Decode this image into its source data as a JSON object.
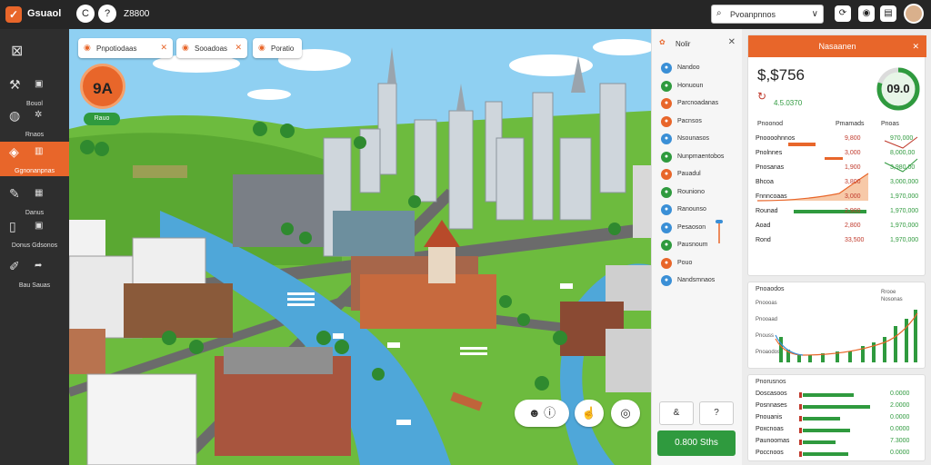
{
  "topbar": {
    "app_name": "Gsuaol",
    "code_text": "Z8800",
    "search_text": "Pvoanpnnos",
    "btn1_glyph": "C",
    "btn2_glyph": "?",
    "icons": [
      "back-icon",
      "help-icon",
      "search-icon",
      "refresh-icon",
      "camera-icon",
      "document-icon",
      "avatar"
    ]
  },
  "sidebar": {
    "items": [
      {
        "label": "Bouol",
        "icon": "wrench-icon"
      },
      {
        "label": "Rnaos",
        "icon": "globe-icon"
      },
      {
        "label": "Ggnonanpnas",
        "icon": "palette-icon"
      },
      {
        "label": "Danus",
        "icon": "tools-icon"
      },
      {
        "label": "Donus Gdsonos",
        "icon": "phone-icon"
      },
      {
        "label": "Bau Sauas",
        "icon": "edit-icon"
      }
    ]
  },
  "map": {
    "chips": [
      {
        "label": "Pnpotiodaas"
      },
      {
        "label": "Sooadoas"
      },
      {
        "label": "Poratio"
      }
    ],
    "score": "9A",
    "score_sub": "Rauo",
    "controls": [
      "person-icon",
      "info-icon",
      "pointer-icon",
      "chat-icon"
    ]
  },
  "midpanel": {
    "title": "Nolir",
    "rows": [
      {
        "label": "Nandoo",
        "color": "#3a8fd6"
      },
      {
        "label": "Honuoun",
        "color": "#2f9a3e"
      },
      {
        "label": "Parcnoadanas",
        "color": "#e8662a"
      },
      {
        "label": "Pacnsos",
        "color": "#e8662a"
      },
      {
        "label": "Nsounasos",
        "color": "#3a8fd6"
      },
      {
        "label": "Nunpmaentobos",
        "color": "#2f9a3e"
      },
      {
        "label": "Pauadul",
        "color": "#e8662a"
      },
      {
        "label": "Rouniono",
        "color": "#2f9a3e"
      },
      {
        "label": "Ranounso",
        "color": "#3a8fd6"
      },
      {
        "label": "Pesaoson",
        "color": "#3a8fd6"
      },
      {
        "label": "Pausnoum",
        "color": "#2f9a3e"
      },
      {
        "label": "Pouo",
        "color": "#e8662a"
      },
      {
        "label": "Nandsmnaos",
        "color": "#3a8fd6"
      }
    ],
    "btn_left": "&",
    "btn_right": "?",
    "cta": "0.800 Sths"
  },
  "rightpanel": {
    "title": "Nasaanen",
    "big_value": "$,$756",
    "ring_value": "09.0",
    "ring_fraction": 0.8,
    "delta": "4.5.0370",
    "headers": [
      "Pnoonod",
      "Pmamads",
      "Pnoas"
    ],
    "rows": [
      {
        "name": "Pnoooohnnos",
        "v1": "9,800",
        "v2": "970,000"
      },
      {
        "name": "Pnolnnes",
        "v1": "3,000",
        "v2": "8,000,00"
      },
      {
        "name": "Pnosanas",
        "v1": "1,900",
        "v2": "3,980,00"
      },
      {
        "name": "Bhcoa",
        "v1": "3,800",
        "v2": "3,000,000"
      },
      {
        "name": "Fnnncoaas",
        "v1": "3,000",
        "v2": "1,970,000"
      },
      {
        "name": "Rounad",
        "v1": "2,900",
        "v2": "1,970,000"
      },
      {
        "name": "Aoad",
        "v1": "2,800",
        "v2": "1,970,000"
      },
      {
        "name": "Rond",
        "v1": "33,500",
        "v2": "1,970,000"
      }
    ],
    "chart_title": "Pnoaodos",
    "chart_yticks": [
      "Pnoooas",
      "Pnooaad",
      "Pnouss",
      "Pnoaodos"
    ],
    "chart_legend": [
      "Rrooe",
      "Nosonas"
    ],
    "list_title": "Pnorusnos",
    "list": [
      {
        "name": "Doscasoos",
        "value": "0.0000",
        "bar": 0.62
      },
      {
        "name": "Posnnases",
        "value": "2.0000",
        "bar": 0.82
      },
      {
        "name": "Pnouanis",
        "value": "0.0000",
        "bar": 0.45
      },
      {
        "name": "Poxcnoas",
        "value": "0.0000",
        "bar": 0.58
      },
      {
        "name": "Paunoomas",
        "value": "7.3000",
        "bar": 0.4
      },
      {
        "name": "Poccnoos",
        "value": "0.0000",
        "bar": 0.55
      }
    ]
  },
  "colors": {
    "accent": "#e8662a",
    "green": "#2f9a3e",
    "red": "#c0392b",
    "blue": "#3a8fd6",
    "topbar": "#262626"
  }
}
